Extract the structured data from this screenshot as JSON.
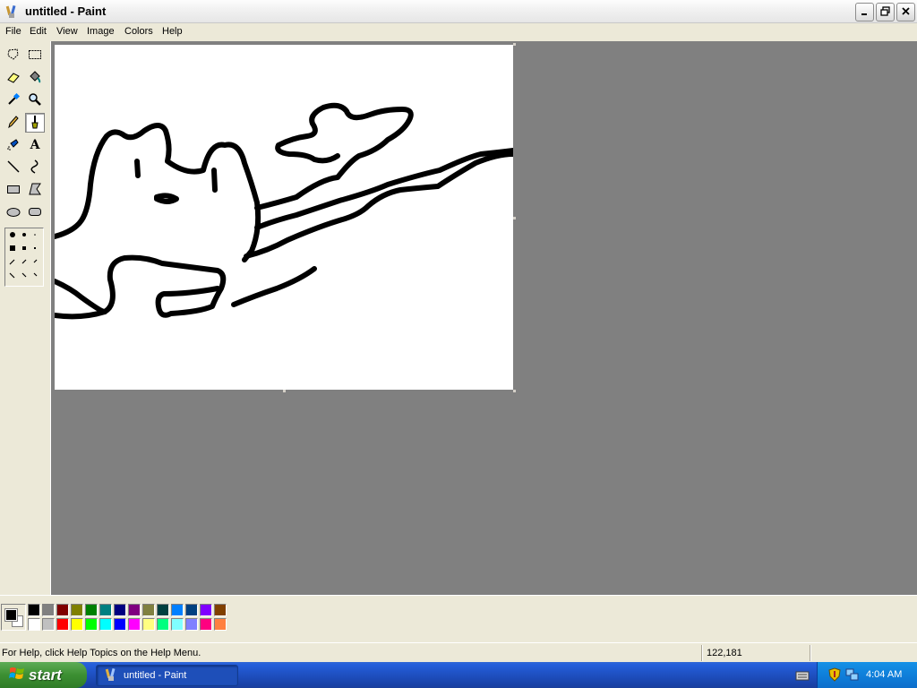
{
  "window": {
    "title": "untitled - Paint"
  },
  "menu": {
    "items": [
      "File",
      "Edit",
      "View",
      "Image",
      "Colors",
      "Help"
    ]
  },
  "toolbox": {
    "tools": [
      {
        "name": "free-form-select-icon"
      },
      {
        "name": "select-icon"
      },
      {
        "name": "eraser-icon"
      },
      {
        "name": "fill-bucket-icon"
      },
      {
        "name": "pick-color-icon"
      },
      {
        "name": "magnifier-icon"
      },
      {
        "name": "pencil-icon"
      },
      {
        "name": "brush-icon",
        "active": true
      },
      {
        "name": "airbrush-icon"
      },
      {
        "name": "text-icon",
        "glyph": "A"
      },
      {
        "name": "line-icon"
      },
      {
        "name": "curve-icon"
      },
      {
        "name": "rectangle-icon"
      },
      {
        "name": "polygon-icon"
      },
      {
        "name": "ellipse-icon"
      },
      {
        "name": "rounded-rectangle-icon"
      }
    ]
  },
  "palette": {
    "foreground": "#000000",
    "background": "#ffffff",
    "row1": [
      "#000000",
      "#808080",
      "#800000",
      "#808000",
      "#008000",
      "#008080",
      "#000080",
      "#800080",
      "#808040",
      "#004040",
      "#0080ff",
      "#004080",
      "#8000ff",
      "#804000"
    ],
    "row2": [
      "#ffffff",
      "#c0c0c0",
      "#ff0000",
      "#ffff00",
      "#00ff00",
      "#00ffff",
      "#0000ff",
      "#ff00ff",
      "#ffff80",
      "#00ff80",
      "#80ffff",
      "#8080ff",
      "#ff0080",
      "#ff8040"
    ]
  },
  "status": {
    "help_text": "For Help, click Help Topics on the Help Menu.",
    "coords": "122,181"
  },
  "taskbar": {
    "start_label": "start",
    "task_label": "untitled - Paint",
    "clock": "4:04 AM"
  }
}
